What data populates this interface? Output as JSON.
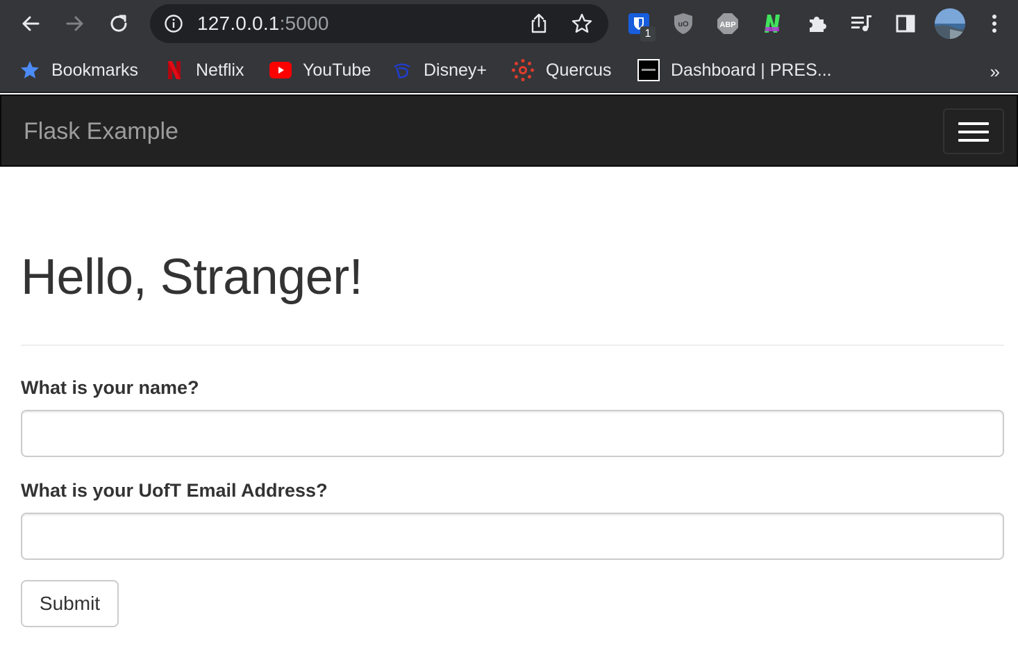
{
  "browser": {
    "url_host": "127.0.0.1",
    "url_port": ":5000",
    "extensions": {
      "bitwarden_badge": "1"
    },
    "bookmarks": [
      {
        "label": "Bookmarks",
        "icon": "star-icon"
      },
      {
        "label": "Netflix",
        "icon": "netflix-icon"
      },
      {
        "label": "YouTube",
        "icon": "youtube-icon"
      },
      {
        "label": "Disney+",
        "icon": "disney-icon"
      },
      {
        "label": "Quercus",
        "icon": "quercus-icon"
      },
      {
        "label": "Dashboard | PRES...",
        "icon": "dashboard-icon"
      }
    ],
    "overflow": "»"
  },
  "navbar": {
    "brand": "Flask Example"
  },
  "page": {
    "title": "Hello, Stranger!",
    "form": {
      "name_label": "What is your name?",
      "name_value": "",
      "email_label": "What is your UofT Email Address?",
      "email_value": "",
      "submit_label": "Submit"
    }
  },
  "colors": {
    "chrome": "#35363a",
    "omnibox": "#202124",
    "navbar": "#222222",
    "brand_text": "#9d9d9d",
    "text": "#333333"
  }
}
